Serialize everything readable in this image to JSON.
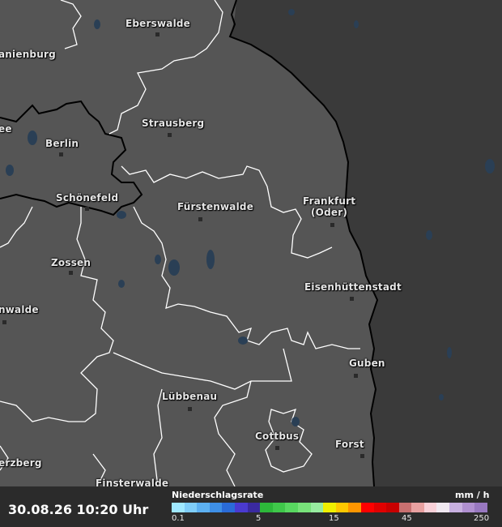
{
  "map": {
    "cities": [
      {
        "name": "Eberswalde"
      },
      {
        "name": "anienburg"
      },
      {
        "name": "Strausberg"
      },
      {
        "name": "ee"
      },
      {
        "name": "Berlin"
      },
      {
        "name": "Schönefeld"
      },
      {
        "name": "Fürstenwalde"
      },
      {
        "name": "Frankfurt"
      },
      {
        "name": "(Oder)"
      },
      {
        "name": "Zossen"
      },
      {
        "name": "Eisenhüttenstadt"
      },
      {
        "name": "nwalde"
      },
      {
        "name": "Guben"
      },
      {
        "name": "Lübbenau"
      },
      {
        "name": "Cottbus"
      },
      {
        "name": "Forst"
      },
      {
        "name": "erzberg"
      },
      {
        "name": "Finsterwalde"
      }
    ]
  },
  "footer": {
    "timestamp": "30.08.26 10:20 Uhr",
    "legend_title": "Niederschlagsrate",
    "legend_unit": "mm / h",
    "ticks": [
      "0.1",
      "5",
      "15",
      "45",
      "250"
    ],
    "colors": [
      "#9fe8ff",
      "#7fcdf8",
      "#5db0f0",
      "#3e8fe6",
      "#2a6bd8",
      "#4a3ad0",
      "#3a2aa0",
      "#2db83a",
      "#3fc84a",
      "#58d860",
      "#78e27a",
      "#98eca0",
      "#f0f000",
      "#ffc800",
      "#ff9600",
      "#ff0000",
      "#e00000",
      "#c80000",
      "#c87070",
      "#e8a0a0",
      "#f8d0d8",
      "#f0e8f0",
      "#c8b0e0",
      "#b090d0",
      "#9878c0"
    ]
  }
}
